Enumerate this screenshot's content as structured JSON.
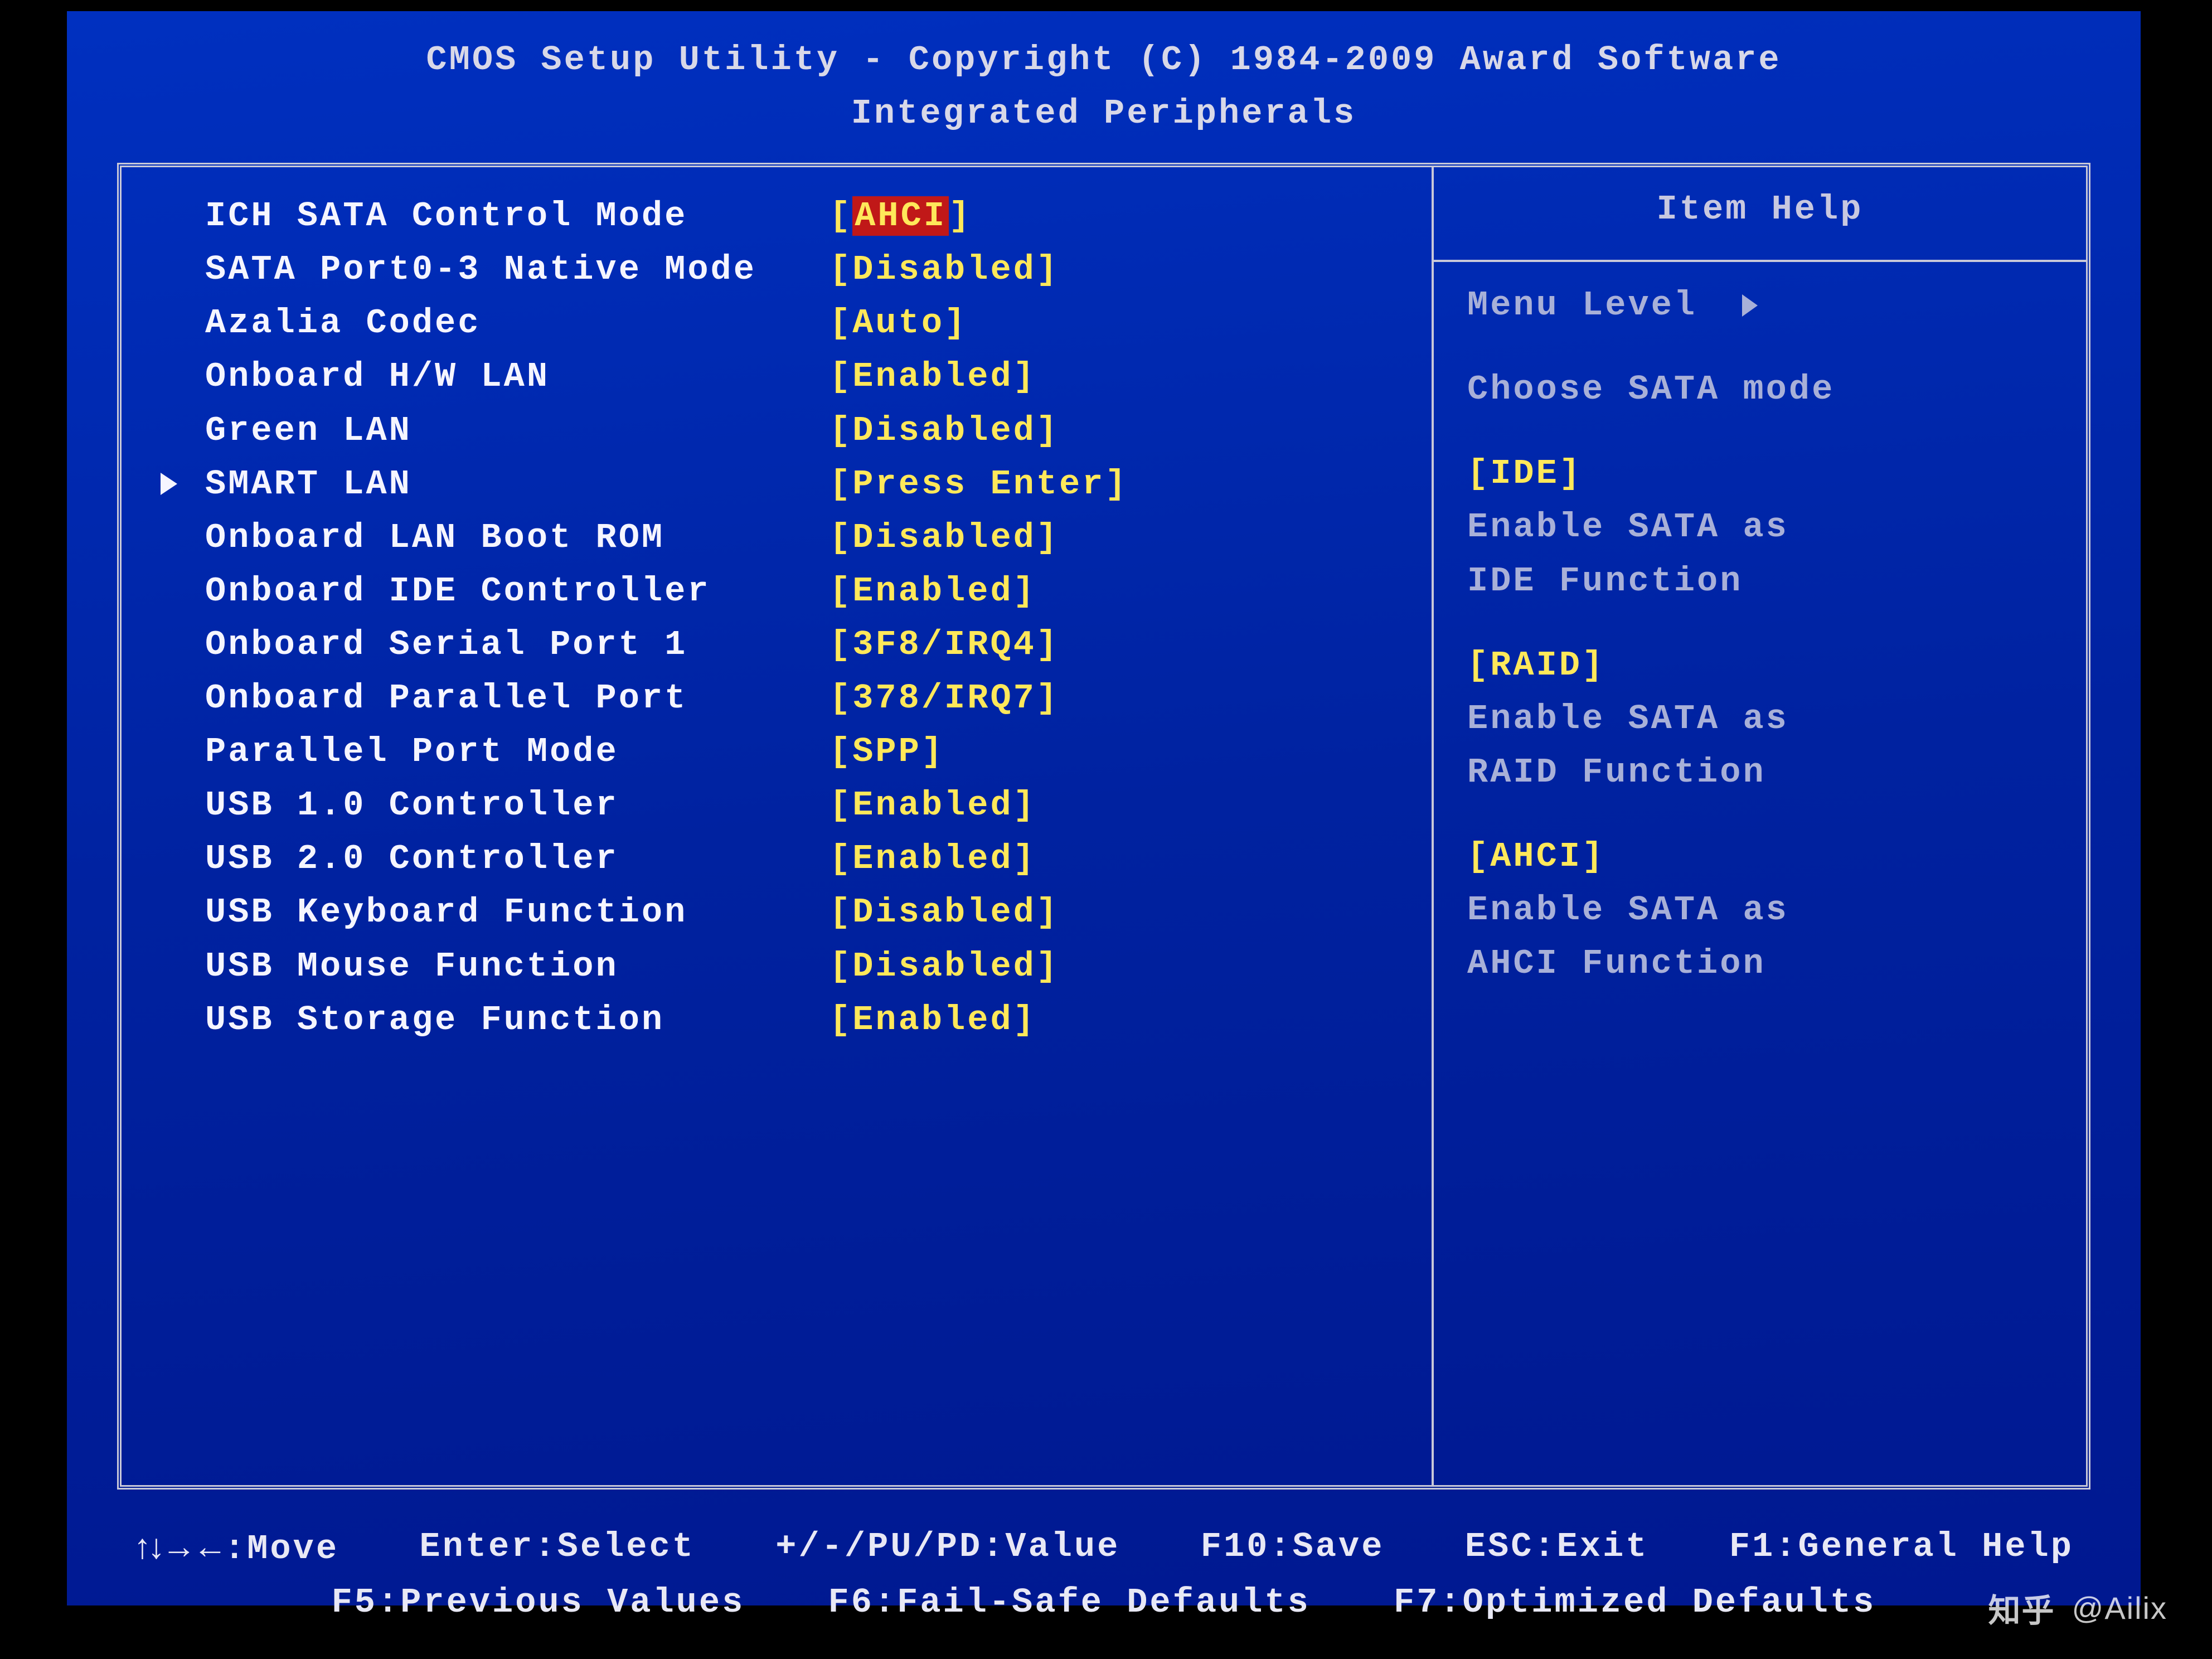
{
  "header": {
    "line1": "CMOS Setup Utility - Copyright (C) 1984-2009 Award Software",
    "line2": "Integrated Peripherals"
  },
  "menu": {
    "items": [
      {
        "label": "ICH SATA Control Mode",
        "value": "AHCI",
        "highlighted": true,
        "submenu": false
      },
      {
        "label": "SATA Port0-3 Native Mode",
        "value": "Disabled",
        "highlighted": false,
        "submenu": false
      },
      {
        "label": "Azalia Codec",
        "value": "Auto",
        "highlighted": false,
        "submenu": false
      },
      {
        "label": "Onboard H/W LAN",
        "value": "Enabled",
        "highlighted": false,
        "submenu": false
      },
      {
        "label": "Green LAN",
        "value": "Disabled",
        "highlighted": false,
        "submenu": false
      },
      {
        "label": "SMART LAN",
        "value": "Press Enter",
        "highlighted": false,
        "submenu": true
      },
      {
        "label": "Onboard LAN Boot ROM",
        "value": "Disabled",
        "highlighted": false,
        "submenu": false
      },
      {
        "label": "Onboard IDE Controller",
        "value": "Enabled",
        "highlighted": false,
        "submenu": false
      },
      {
        "label": "Onboard Serial Port 1",
        "value": "3F8/IRQ4",
        "highlighted": false,
        "submenu": false
      },
      {
        "label": "Onboard Parallel Port",
        "value": "378/IRQ7",
        "highlighted": false,
        "submenu": false
      },
      {
        "label": "Parallel Port Mode",
        "value": "SPP",
        "highlighted": false,
        "submenu": false
      },
      {
        "label": "USB 1.0 Controller",
        "value": "Enabled",
        "highlighted": false,
        "submenu": false
      },
      {
        "label": "USB 2.0 Controller",
        "value": "Enabled",
        "highlighted": false,
        "submenu": false
      },
      {
        "label": "USB Keyboard Function",
        "value": "Disabled",
        "highlighted": false,
        "submenu": false
      },
      {
        "label": "USB Mouse Function",
        "value": "Disabled",
        "highlighted": false,
        "submenu": false
      },
      {
        "label": "USB Storage Function",
        "value": "Enabled",
        "highlighted": false,
        "submenu": false
      }
    ]
  },
  "help": {
    "title": "Item Help",
    "menu_level_label": "Menu Level",
    "intro": "Choose SATA mode",
    "options": [
      {
        "name": "[IDE]",
        "desc1": "Enable SATA as",
        "desc2": "IDE Function"
      },
      {
        "name": "[RAID]",
        "desc1": "Enable SATA as",
        "desc2": "RAID Function"
      },
      {
        "name": "[AHCI]",
        "desc1": "Enable SATA as",
        "desc2": "AHCI Function"
      }
    ]
  },
  "footer": {
    "row1": {
      "move": "↑↓→←:Move",
      "select": "Enter:Select",
      "value": "+/-/PU/PD:Value",
      "save": "F10:Save",
      "exit": "ESC:Exit",
      "help": "F1:General Help"
    },
    "row2": {
      "prev": "F5:Previous Values",
      "fail": "F6:Fail-Safe Defaults",
      "opt": "F7:Optimized Defaults"
    }
  },
  "watermark": {
    "logo": "知乎",
    "author": "@Ailix"
  }
}
